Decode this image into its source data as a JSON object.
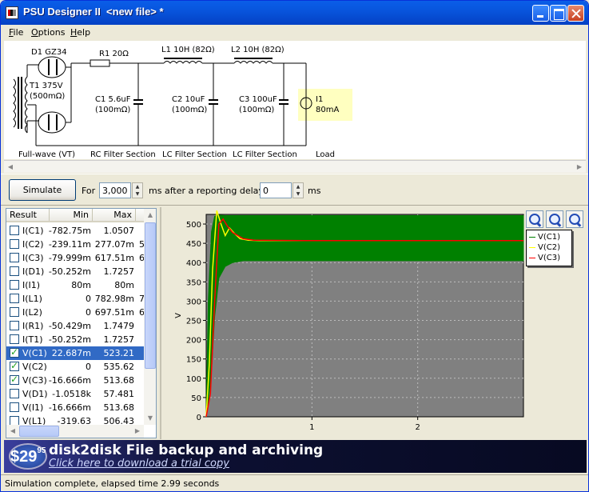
{
  "window": {
    "title": "PSU Designer II  <new file> *"
  },
  "menu": [
    {
      "accel": "F",
      "rest": "ile"
    },
    {
      "accel": "O",
      "rest": "ptions"
    },
    {
      "accel": "H",
      "rest": "elp"
    }
  ],
  "schematic": {
    "d1": "D1 GZ34",
    "t1": "T1 375V\n(500mΩ)",
    "r1": "R1 20Ω",
    "l1": "L1 10H (82Ω)",
    "l2": "L2 10H (82Ω)",
    "c1": "C1 5.6uF\n(100mΩ)",
    "c2": "C2 10uF\n(100mΩ)",
    "c3": "C3 100uF\n(100mΩ)",
    "i1": "I1\n80mA",
    "sections": [
      "Full-wave (VT)",
      "RC Filter Section",
      "LC Filter Section",
      "LC Filter Section",
      "Load"
    ]
  },
  "simulation": {
    "button": "Simulate",
    "for_label": "For",
    "duration": "3,000",
    "ms1": "ms",
    "after_label": "after a reporting delay of",
    "delay": "0",
    "ms2": "ms"
  },
  "results": {
    "columns": [
      "Result",
      "Min",
      "Max"
    ],
    "rows": [
      {
        "name": "I(C1)",
        "min": "-782.75m",
        "max": "1.0507",
        "ext": "",
        "checked": false,
        "selected": false
      },
      {
        "name": "I(C2)",
        "min": "-239.11m",
        "max": "277.07m",
        "ext": "5",
        "checked": false,
        "selected": false
      },
      {
        "name": "I(C3)",
        "min": "-79.999m",
        "max": "617.51m",
        "ext": "6",
        "checked": false,
        "selected": false
      },
      {
        "name": "I(D1)",
        "min": "-50.252m",
        "max": "1.7257",
        "ext": "",
        "checked": false,
        "selected": false
      },
      {
        "name": "I(I1)",
        "min": "80m",
        "max": "80m",
        "ext": "",
        "checked": false,
        "selected": false
      },
      {
        "name": "I(L1)",
        "min": "0",
        "max": "782.98m",
        "ext": "7",
        "checked": false,
        "selected": false
      },
      {
        "name": "I(L2)",
        "min": "0",
        "max": "697.51m",
        "ext": "6",
        "checked": false,
        "selected": false
      },
      {
        "name": "I(R1)",
        "min": "-50.429m",
        "max": "1.7479",
        "ext": "",
        "checked": false,
        "selected": false
      },
      {
        "name": "I(T1)",
        "min": "-50.252m",
        "max": "1.7257",
        "ext": "",
        "checked": false,
        "selected": false
      },
      {
        "name": "V(C1)",
        "min": "22.687m",
        "max": "523.21",
        "ext": "",
        "checked": true,
        "selected": true
      },
      {
        "name": "V(C2)",
        "min": "0",
        "max": "535.62",
        "ext": "",
        "checked": true,
        "selected": false
      },
      {
        "name": "V(C3)",
        "min": "-16.666m",
        "max": "513.68",
        "ext": "",
        "checked": true,
        "selected": false
      },
      {
        "name": "V(D1)",
        "min": "-1.0518k",
        "max": "57.481",
        "ext": "",
        "checked": false,
        "selected": false
      },
      {
        "name": "V(I1)",
        "min": "-16.666m",
        "max": "513.68",
        "ext": "",
        "checked": false,
        "selected": false
      },
      {
        "name": "V(L1)",
        "min": "-319.63",
        "max": "506.43",
        "ext": "",
        "checked": false,
        "selected": false
      }
    ]
  },
  "chart_data": {
    "type": "line",
    "ylabel": "V",
    "ylim": [
      0,
      525
    ],
    "xlim": [
      0,
      3
    ],
    "yticks": [
      0,
      50,
      100,
      150,
      200,
      250,
      300,
      350,
      400,
      450,
      500
    ],
    "xticks": [
      1,
      2
    ],
    "grid": true,
    "legend": "top-right",
    "series": [
      {
        "name": "V(C1)",
        "color": "#008000",
        "x": [
          0,
          0.02,
          0.05,
          0.08,
          0.12,
          0.18,
          0.25,
          0.35,
          0.6,
          1.0,
          2.0,
          3.0
        ],
        "ymin": [
          0,
          40,
          120,
          260,
          360,
          390,
          400,
          405,
          405,
          405,
          405,
          405
        ],
        "ymax": [
          0,
          300,
          480,
          520,
          523,
          522,
          522,
          522,
          522,
          522,
          522,
          522
        ]
      },
      {
        "name": "V(C2)",
        "color": "#ffff00",
        "x": [
          0,
          0.03,
          0.06,
          0.1,
          0.14,
          0.18,
          0.22,
          0.27,
          0.32,
          0.4,
          0.5,
          1.0,
          2.0,
          3.0
        ],
        "y": [
          0,
          140,
          380,
          535,
          500,
          470,
          490,
          475,
          462,
          458,
          457,
          457,
          457,
          457
        ]
      },
      {
        "name": "V(C3)",
        "color": "#ff0000",
        "x": [
          0,
          0.04,
          0.08,
          0.12,
          0.16,
          0.2,
          0.25,
          0.3,
          0.35,
          0.45,
          1.0,
          2.0,
          3.0
        ],
        "y": [
          0,
          60,
          300,
          500,
          513,
          495,
          478,
          470,
          462,
          458,
          457,
          457,
          457
        ]
      }
    ]
  },
  "banner": {
    "price": "$29",
    "cents": "95",
    "title": "disk2disk File backup and archiving",
    "link": "Click here to download a trial copy"
  },
  "status": {
    "text": "Simulation complete, elapsed time 2.99 seconds"
  }
}
